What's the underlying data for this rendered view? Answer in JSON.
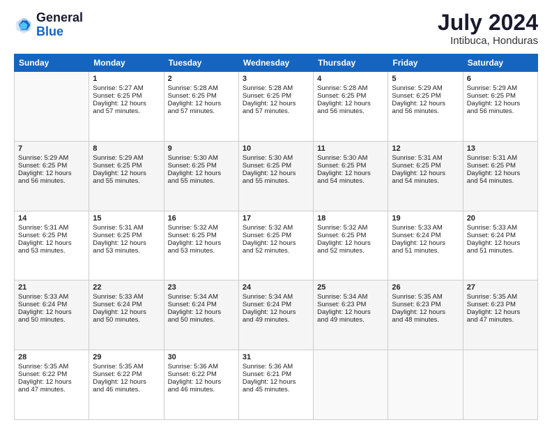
{
  "logo": {
    "line1": "General",
    "line2": "Blue"
  },
  "title": "July 2024",
  "location": "Intibuca, Honduras",
  "days": [
    "Sunday",
    "Monday",
    "Tuesday",
    "Wednesday",
    "Thursday",
    "Friday",
    "Saturday"
  ],
  "weeks": [
    [
      {
        "day": "",
        "info": ""
      },
      {
        "day": "1",
        "info": "Sunrise: 5:27 AM\nSunset: 6:25 PM\nDaylight: 12 hours\nand 57 minutes."
      },
      {
        "day": "2",
        "info": "Sunrise: 5:28 AM\nSunset: 6:25 PM\nDaylight: 12 hours\nand 57 minutes."
      },
      {
        "day": "3",
        "info": "Sunrise: 5:28 AM\nSunset: 6:25 PM\nDaylight: 12 hours\nand 57 minutes."
      },
      {
        "day": "4",
        "info": "Sunrise: 5:28 AM\nSunset: 6:25 PM\nDaylight: 12 hours\nand 56 minutes."
      },
      {
        "day": "5",
        "info": "Sunrise: 5:29 AM\nSunset: 6:25 PM\nDaylight: 12 hours\nand 56 minutes."
      },
      {
        "day": "6",
        "info": "Sunrise: 5:29 AM\nSunset: 6:25 PM\nDaylight: 12 hours\nand 56 minutes."
      }
    ],
    [
      {
        "day": "7",
        "info": "Sunrise: 5:29 AM\nSunset: 6:25 PM\nDaylight: 12 hours\nand 56 minutes."
      },
      {
        "day": "8",
        "info": "Sunrise: 5:29 AM\nSunset: 6:25 PM\nDaylight: 12 hours\nand 55 minutes."
      },
      {
        "day": "9",
        "info": "Sunrise: 5:30 AM\nSunset: 6:25 PM\nDaylight: 12 hours\nand 55 minutes."
      },
      {
        "day": "10",
        "info": "Sunrise: 5:30 AM\nSunset: 6:25 PM\nDaylight: 12 hours\nand 55 minutes."
      },
      {
        "day": "11",
        "info": "Sunrise: 5:30 AM\nSunset: 6:25 PM\nDaylight: 12 hours\nand 54 minutes."
      },
      {
        "day": "12",
        "info": "Sunrise: 5:31 AM\nSunset: 6:25 PM\nDaylight: 12 hours\nand 54 minutes."
      },
      {
        "day": "13",
        "info": "Sunrise: 5:31 AM\nSunset: 6:25 PM\nDaylight: 12 hours\nand 54 minutes."
      }
    ],
    [
      {
        "day": "14",
        "info": "Sunrise: 5:31 AM\nSunset: 6:25 PM\nDaylight: 12 hours\nand 53 minutes."
      },
      {
        "day": "15",
        "info": "Sunrise: 5:31 AM\nSunset: 6:25 PM\nDaylight: 12 hours\nand 53 minutes."
      },
      {
        "day": "16",
        "info": "Sunrise: 5:32 AM\nSunset: 6:25 PM\nDaylight: 12 hours\nand 53 minutes."
      },
      {
        "day": "17",
        "info": "Sunrise: 5:32 AM\nSunset: 6:25 PM\nDaylight: 12 hours\nand 52 minutes."
      },
      {
        "day": "18",
        "info": "Sunrise: 5:32 AM\nSunset: 6:25 PM\nDaylight: 12 hours\nand 52 minutes."
      },
      {
        "day": "19",
        "info": "Sunrise: 5:33 AM\nSunset: 6:24 PM\nDaylight: 12 hours\nand 51 minutes."
      },
      {
        "day": "20",
        "info": "Sunrise: 5:33 AM\nSunset: 6:24 PM\nDaylight: 12 hours\nand 51 minutes."
      }
    ],
    [
      {
        "day": "21",
        "info": "Sunrise: 5:33 AM\nSunset: 6:24 PM\nDaylight: 12 hours\nand 50 minutes."
      },
      {
        "day": "22",
        "info": "Sunrise: 5:33 AM\nSunset: 6:24 PM\nDaylight: 12 hours\nand 50 minutes."
      },
      {
        "day": "23",
        "info": "Sunrise: 5:34 AM\nSunset: 6:24 PM\nDaylight: 12 hours\nand 50 minutes."
      },
      {
        "day": "24",
        "info": "Sunrise: 5:34 AM\nSunset: 6:24 PM\nDaylight: 12 hours\nand 49 minutes."
      },
      {
        "day": "25",
        "info": "Sunrise: 5:34 AM\nSunset: 6:23 PM\nDaylight: 12 hours\nand 49 minutes."
      },
      {
        "day": "26",
        "info": "Sunrise: 5:35 AM\nSunset: 6:23 PM\nDaylight: 12 hours\nand 48 minutes."
      },
      {
        "day": "27",
        "info": "Sunrise: 5:35 AM\nSunset: 6:23 PM\nDaylight: 12 hours\nand 47 minutes."
      }
    ],
    [
      {
        "day": "28",
        "info": "Sunrise: 5:35 AM\nSunset: 6:22 PM\nDaylight: 12 hours\nand 47 minutes."
      },
      {
        "day": "29",
        "info": "Sunrise: 5:35 AM\nSunset: 6:22 PM\nDaylight: 12 hours\nand 46 minutes."
      },
      {
        "day": "30",
        "info": "Sunrise: 5:36 AM\nSunset: 6:22 PM\nDaylight: 12 hours\nand 46 minutes."
      },
      {
        "day": "31",
        "info": "Sunrise: 5:36 AM\nSunset: 6:21 PM\nDaylight: 12 hours\nand 45 minutes."
      },
      {
        "day": "",
        "info": ""
      },
      {
        "day": "",
        "info": ""
      },
      {
        "day": "",
        "info": ""
      }
    ]
  ]
}
